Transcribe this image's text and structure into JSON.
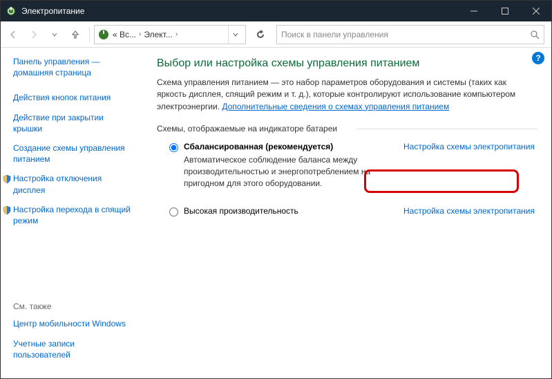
{
  "window": {
    "title": "Электропитание"
  },
  "nav": {
    "breadcrumb": {
      "part1": "« Вс...",
      "part2": "Элект..."
    },
    "search_placeholder": "Поиск в панели управления"
  },
  "sidebar": {
    "home": "Панель управления — домашняя страница",
    "links": [
      "Действия кнопок питания",
      "Действие при закрытии крышки",
      "Создание схемы управления питанием",
      "Настройка отключения дисплея",
      "Настройка перехода в спящий режим"
    ],
    "see_also_label": "См. также",
    "see_also": [
      "Центр мобильности Windows",
      "Учетные записи пользователей"
    ]
  },
  "main": {
    "heading": "Выбор или настройка схемы управления питанием",
    "description": "Схема управления питанием — это набор параметров оборудования и системы (таких как яркость дисплея, спящий режим и т. д.), которые контролируют использование компьютером электроэнергии. ",
    "description_link": "Дополнительные сведения о схемах управления питанием",
    "group_label": "Схемы, отображаемые на индикаторе батареи",
    "plans": [
      {
        "title": "Сбалансированная (рекомендуется)",
        "desc": "Автоматическое соблюдение баланса между производительностью и энергопотреблением на пригодном для этого оборудовании.",
        "link": "Настройка схемы электропитания",
        "selected": true
      },
      {
        "title": "Высокая производительность",
        "desc": "",
        "link": "Настройка схемы электропитания",
        "selected": false
      }
    ]
  }
}
